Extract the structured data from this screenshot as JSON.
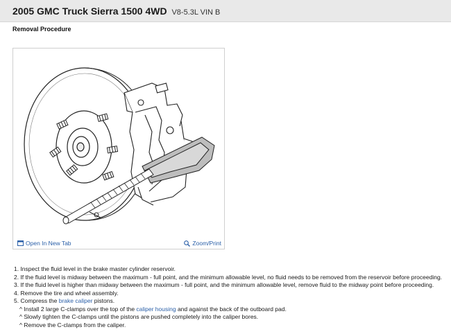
{
  "header": {
    "title": "2005 GMC Truck Sierra 1500 4WD",
    "subtitle": "V8-5.3L VIN B"
  },
  "section_title": "Removal Procedure",
  "figure": {
    "open_new_tab_label": "Open In New Tab",
    "open_new_tab_icon": "open-window-icon",
    "zoom_print_label": "Zoom/Print",
    "zoom_icon": "magnifier-icon",
    "link_color": "#2a5fa8"
  },
  "steps": [
    {
      "text": "1. Inspect the fluid level in the brake master cylinder reservoir."
    },
    {
      "text": "2. If the fluid level is midway between the maximum - full point, and the minimum allowable level, no fluid needs to be removed from the reservoir before proceeding."
    },
    {
      "text": "3. If the fluid level is higher than midway between the maximum - full point, and the minimum allowable level, remove fluid to the midway point before proceeding."
    },
    {
      "text": "4. Remove the tire and wheel assembly."
    },
    {
      "pre": "5. Compress the ",
      "link": "brake caliper",
      "post": " pistons."
    }
  ],
  "substeps": [
    {
      "pre": "^  Install 2 large C-clamps over the top of the ",
      "link": "caliper housing",
      "post": " and against the back of the outboard pad."
    },
    {
      "text": "^  Slowly tighten the C-clamps until the pistons are pushed completely into the caliper bores."
    },
    {
      "text": "^  Remove the C-clamps from the caliper."
    }
  ]
}
